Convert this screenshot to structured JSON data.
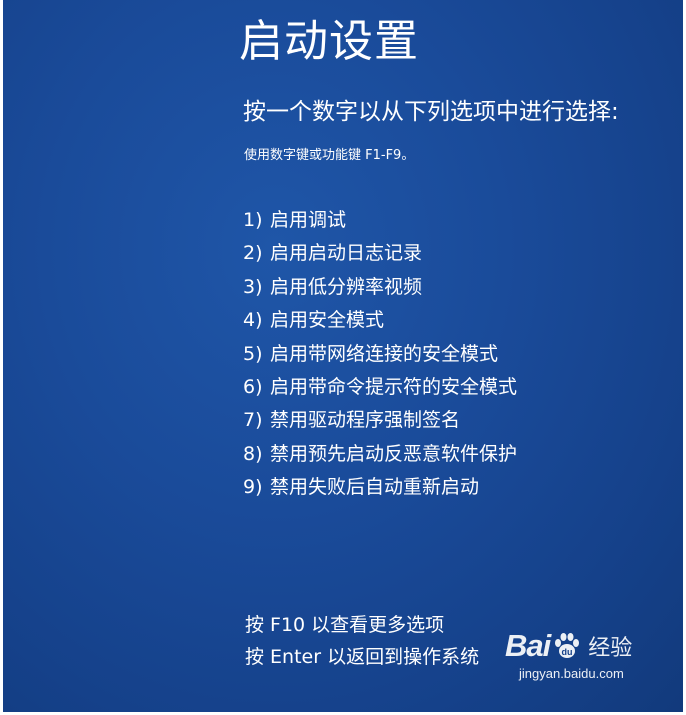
{
  "title": "启动设置",
  "prompt": "按一个数字以从下列选项中进行选择:",
  "hint": "使用数字键或功能键 F1-F9。",
  "options": [
    {
      "num": "1)",
      "label": "启用调试"
    },
    {
      "num": "2)",
      "label": "启用启动日志记录"
    },
    {
      "num": "3)",
      "label": "启用低分辨率视频"
    },
    {
      "num": "4)",
      "label": "启用安全模式"
    },
    {
      "num": "5)",
      "label": "启用带网络连接的安全模式"
    },
    {
      "num": "6)",
      "label": "启用带命令提示符的安全模式"
    },
    {
      "num": "7)",
      "label": "禁用驱动程序强制签名"
    },
    {
      "num": "8)",
      "label": "禁用预先启动反恶意软件保护"
    },
    {
      "num": "9)",
      "label": "禁用失败后自动重新启动"
    }
  ],
  "footer": {
    "more_options": "按 F10 以查看更多选项",
    "return_os": "按 Enter 以返回到操作系统"
  },
  "watermark": {
    "brand_left": "Bai",
    "brand_right": "du",
    "brand_suffix": "经验",
    "url": "jingyan.baidu.com",
    "icon": "baidu-paw-icon"
  },
  "colors": {
    "background": "#1a4b9a",
    "text": "#ffffff"
  }
}
